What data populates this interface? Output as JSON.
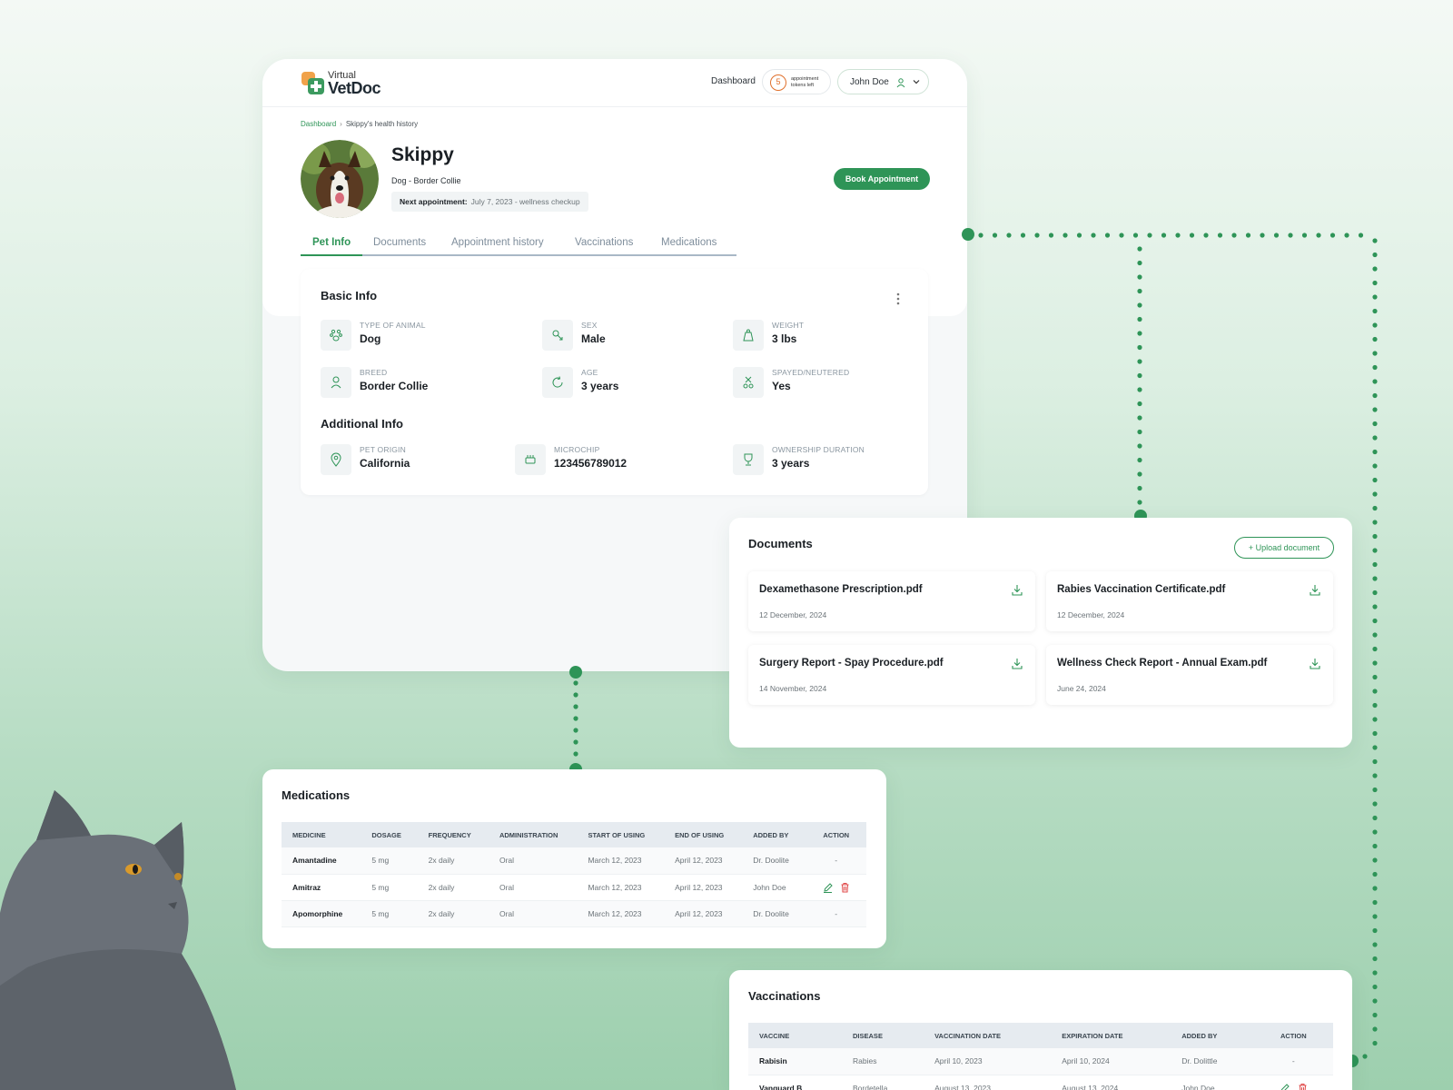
{
  "app": {
    "logo_top": "Virtual",
    "logo_bottom": "VetDoc"
  },
  "topbar": {
    "nav_dashboard": "Dashboard",
    "tokens_count": "5",
    "tokens_text": "appointment tokens left",
    "user_name": "John Doe"
  },
  "breadcrumb": {
    "root": "Dashboard",
    "current": "Skippy's health history"
  },
  "pet": {
    "name": "Skippy",
    "species": "Dog - Border Collie",
    "next_appt_label": "Next appointment:",
    "next_appt_value": "July 7, 2023 - wellness checkup",
    "book_label": "Book Appointment"
  },
  "tabs": [
    "Pet Info",
    "Documents",
    "Appointment history",
    "Vaccinations",
    "Medications"
  ],
  "basic_info": {
    "title": "Basic Info",
    "fields": [
      {
        "label": "Type of animal",
        "value": "Dog",
        "icon": "paw-icon"
      },
      {
        "label": "Sex",
        "value": "Male",
        "icon": "gender-icon"
      },
      {
        "label": "Weight",
        "value": "3 lbs",
        "icon": "weight-icon"
      },
      {
        "label": "Breed",
        "value": "Border Collie",
        "icon": "breed-icon"
      },
      {
        "label": "Age",
        "value": "3 years",
        "icon": "age-icon"
      },
      {
        "label": "Spayed/neutered",
        "value": "Yes",
        "icon": "neutered-icon"
      }
    ]
  },
  "additional_info": {
    "title": "Additional Info",
    "fields": [
      {
        "label": "Pet origin",
        "value": "California",
        "icon": "location-pin-icon"
      },
      {
        "label": "Microchip",
        "value": "123456789012",
        "icon": "chip-icon"
      },
      {
        "label": "Ownership duration",
        "value": "3 years",
        "icon": "trophy-icon"
      }
    ]
  },
  "documents": {
    "title": "Documents",
    "upload_label": "+ Upload document",
    "items": [
      {
        "name": "Dexamethasone Prescription.pdf",
        "date": "12 December, 2024"
      },
      {
        "name": "Rabies Vaccination Certificate.pdf",
        "date": "12 December, 2024"
      },
      {
        "name": "Surgery Report - Spay Procedure.pdf",
        "date": "14 November, 2024"
      },
      {
        "name": "Wellness Check Report - Annual Exam.pdf",
        "date": "June 24, 2024"
      }
    ]
  },
  "medications": {
    "title": "Medications",
    "headers": [
      "Medicine",
      "Dosage",
      "Frequency",
      "Administration",
      "Start of using",
      "End of using",
      "Added by",
      "Action"
    ],
    "rows": [
      [
        "Amantadine",
        "5 mg",
        "2x daily",
        "Oral",
        "March 12, 2023",
        "April 12, 2023",
        "Dr. Doolite",
        "-"
      ],
      [
        "Amitraz",
        "5 mg",
        "2x daily",
        "Oral",
        "March 12, 2023",
        "April 12, 2023",
        "John Doe",
        ""
      ],
      [
        "Apomorphine",
        "5 mg",
        "2x daily",
        "Oral",
        "March 12, 2023",
        "April 12, 2023",
        "Dr. Doolite",
        "-"
      ]
    ]
  },
  "vaccinations": {
    "title": "Vaccinations",
    "headers": [
      "Vaccine",
      "Disease",
      "Vaccination date",
      "Expiration date",
      "Added by",
      "Action"
    ],
    "rows": [
      [
        "Rabisin",
        "Rabies",
        "April 10, 2023",
        "April 10, 2024",
        "Dr. Dolittle",
        "-"
      ],
      [
        "Vanguard B",
        "Bordetella",
        "August 13, 2023",
        "August 13, 2024",
        "John Doe",
        ""
      ]
    ]
  },
  "colors": {
    "accent": "#2e9457",
    "token_orange": "#e0702c",
    "delete_red": "#e04848"
  }
}
